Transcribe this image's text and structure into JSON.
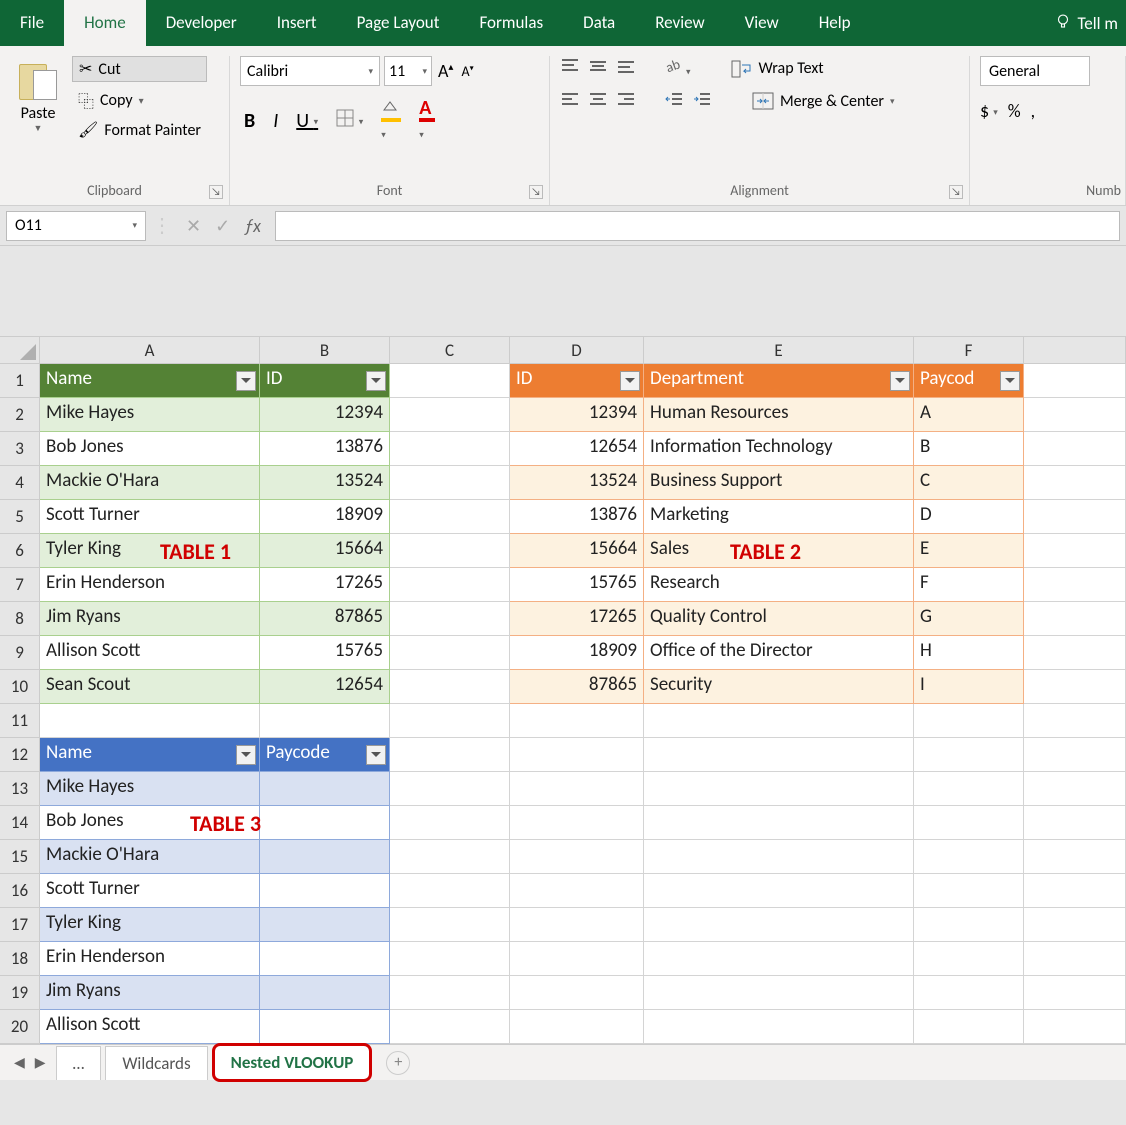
{
  "menu": {
    "file": "File",
    "home": "Home",
    "developer": "Developer",
    "insert": "Insert",
    "page_layout": "Page Layout",
    "formulas": "Formulas",
    "data": "Data",
    "review": "Review",
    "view": "View",
    "help": "Help",
    "tell_me": "Tell m"
  },
  "ribbon": {
    "clipboard": {
      "paste": "Paste",
      "cut": "Cut",
      "copy": "Copy",
      "format_painter": "Format Painter",
      "label": "Clipboard"
    },
    "font": {
      "name": "Calibri",
      "size": "11",
      "label": "Font"
    },
    "alignment": {
      "wrap": "Wrap Text",
      "merge": "Merge & Center",
      "label": "Alignment"
    },
    "number": {
      "format": "General",
      "label": "Numb"
    }
  },
  "namebox": "O11",
  "formula": "",
  "columns": [
    "A",
    "B",
    "C",
    "D",
    "E",
    "F"
  ],
  "table1": {
    "headers": [
      "Name",
      "ID"
    ],
    "rows": [
      [
        "Mike Hayes",
        "12394"
      ],
      [
        "Bob Jones",
        "13876"
      ],
      [
        "Mackie O'Hara",
        "13524"
      ],
      [
        "Scott Turner",
        "18909"
      ],
      [
        "Tyler King",
        "15664"
      ],
      [
        "Erin Henderson",
        "17265"
      ],
      [
        "Jim Ryans",
        "87865"
      ],
      [
        "Allison Scott",
        "15765"
      ],
      [
        "Sean Scout",
        "12654"
      ]
    ]
  },
  "table2": {
    "headers": [
      "ID",
      "Department",
      "Paycod"
    ],
    "rows": [
      [
        "12394",
        "Human Resources",
        "A"
      ],
      [
        "12654",
        "Information Technology",
        "B"
      ],
      [
        "13524",
        "Business Support",
        "C"
      ],
      [
        "13876",
        "Marketing",
        "D"
      ],
      [
        "15664",
        "Sales",
        "E"
      ],
      [
        "15765",
        "Research",
        "F"
      ],
      [
        "17265",
        "Quality Control",
        "G"
      ],
      [
        "18909",
        "Office of the Director",
        "H"
      ],
      [
        "87865",
        "Security",
        "I"
      ]
    ]
  },
  "table3": {
    "headers": [
      "Name",
      "Paycode"
    ],
    "rows": [
      [
        "Mike Hayes",
        ""
      ],
      [
        "Bob Jones",
        ""
      ],
      [
        "Mackie O'Hara",
        ""
      ],
      [
        "Scott Turner",
        ""
      ],
      [
        "Tyler King",
        ""
      ],
      [
        "Erin Henderson",
        ""
      ],
      [
        "Jim Ryans",
        ""
      ],
      [
        "Allison Scott",
        ""
      ]
    ]
  },
  "annotations": {
    "t1": "TABLE 1",
    "t2": "TABLE 2",
    "t3": "TABLE 3"
  },
  "sheets": {
    "dots": "…",
    "wildcards": "Wildcards",
    "nested": "Nested VLOOKUP"
  }
}
